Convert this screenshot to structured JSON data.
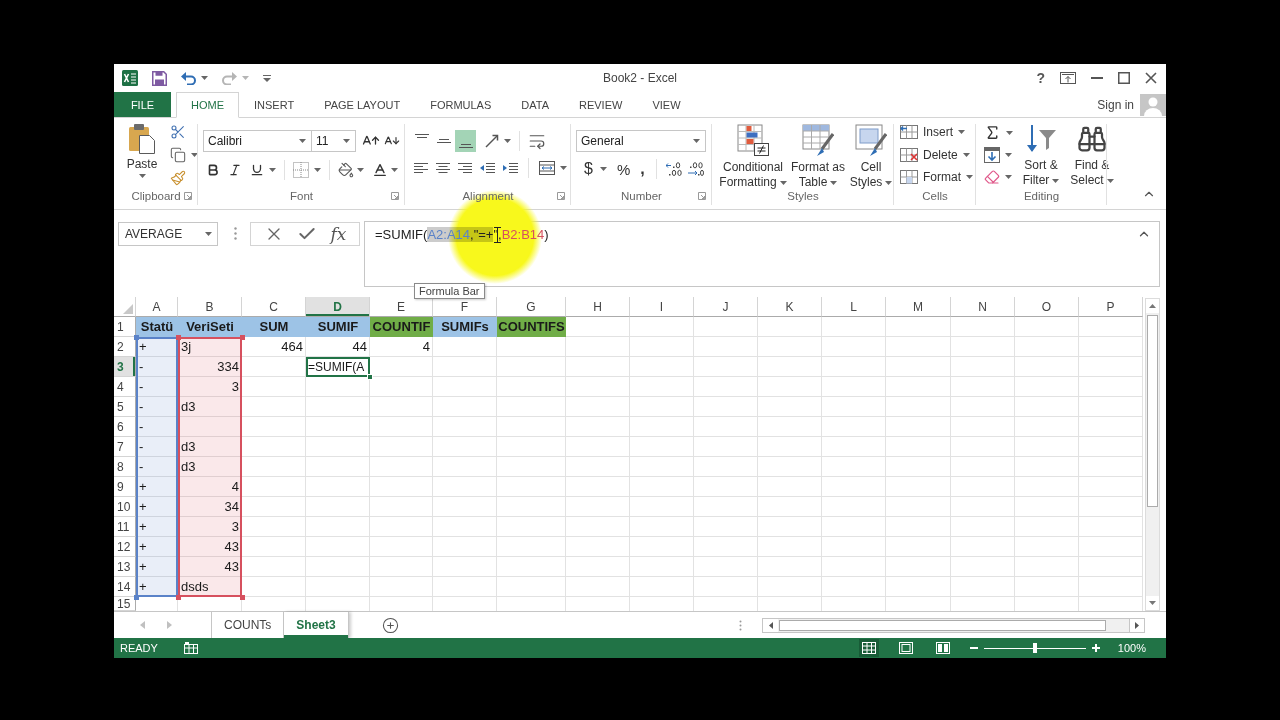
{
  "window": {
    "title": "Book2 - Excel",
    "help": "?"
  },
  "tabs": [
    {
      "label": "FILE",
      "kind": "file",
      "selected": false
    },
    {
      "label": "HOME",
      "kind": "tab",
      "selected": true
    },
    {
      "label": "INSERT",
      "kind": "tab",
      "selected": false
    },
    {
      "label": "PAGE LAYOUT",
      "kind": "tab",
      "selected": false
    },
    {
      "label": "FORMULAS",
      "kind": "tab",
      "selected": false
    },
    {
      "label": "DATA",
      "kind": "tab",
      "selected": false
    },
    {
      "label": "REVIEW",
      "kind": "tab",
      "selected": false
    },
    {
      "label": "VIEW",
      "kind": "tab",
      "selected": false
    }
  ],
  "account": {
    "label": "Sign in"
  },
  "ribbon": {
    "clipboard": {
      "label": "Clipboard",
      "paste": "Paste"
    },
    "font": {
      "label": "Font",
      "font_name": "Calibri",
      "font_size": "11"
    },
    "alignment": {
      "label": "Alignment",
      "vertical": [
        {
          "kind": "top",
          "selected": false
        },
        {
          "kind": "middle",
          "selected": false
        },
        {
          "kind": "bottom",
          "selected": true
        }
      ]
    },
    "number": {
      "label": "Number",
      "format": "General",
      "currency": "$",
      "percent": "%",
      "comma": ","
    },
    "styles": {
      "label": "Styles",
      "buttons": [
        {
          "label": "Conditional Formatting",
          "kind": "conditional"
        },
        {
          "label": "Format as Table",
          "kind": "table"
        },
        {
          "label": "Cell Styles",
          "kind": "cell-styles"
        }
      ]
    },
    "cells": {
      "label": "Cells",
      "buttons": [
        {
          "label": "Insert",
          "kind": "insert"
        },
        {
          "label": "Delete",
          "kind": "delete"
        },
        {
          "label": "Format",
          "kind": "format"
        }
      ]
    },
    "editing": {
      "label": "Editing",
      "buttons": [
        {
          "label": "Sort & Filter",
          "kind": "sort"
        },
        {
          "label": "Find & Select",
          "kind": "find"
        }
      ]
    }
  },
  "formula_bar": {
    "name_box": "AVERAGE",
    "insert_function": "fx",
    "formula": [
      {
        "text": "=SUMIF(",
        "selected": false
      },
      {
        "text": "A2:A14",
        "color": "#5a82c8",
        "selected": true
      },
      {
        "text": ",\"=+",
        "selected": true
      },
      {
        "text": "\",",
        "selected": false
      },
      {
        "text": "B2:B14",
        "color": "#d6505e",
        "selected": false
      },
      {
        "text": ")",
        "selected": false
      }
    ],
    "tooltip": "Formula Bar"
  },
  "grid": {
    "columns": [
      {
        "label": "A",
        "selected": false
      },
      {
        "label": "B",
        "selected": false
      },
      {
        "label": "C",
        "selected": false
      },
      {
        "label": "D",
        "selected": true
      },
      {
        "label": "E",
        "selected": false
      },
      {
        "label": "F",
        "selected": false
      },
      {
        "label": "G",
        "selected": false
      },
      {
        "label": "H",
        "selected": false
      },
      {
        "label": "I",
        "selected": false
      },
      {
        "label": "J",
        "selected": false
      },
      {
        "label": "K",
        "selected": false
      },
      {
        "label": "L",
        "selected": false
      },
      {
        "label": "M",
        "selected": false
      },
      {
        "label": "N",
        "selected": false
      },
      {
        "label": "O",
        "selected": false
      },
      {
        "label": "P",
        "selected": false
      }
    ],
    "rows": [
      {
        "number": "1",
        "selected": false,
        "cells": [
          {
            "text": "Statü",
            "kind": "header",
            "color": "#9dc3e6",
            "active": false
          },
          {
            "text": "VeriSeti",
            "kind": "header",
            "color": "#9dc3e6",
            "active": false
          },
          {
            "text": "SUM",
            "kind": "header",
            "color": "#9dc3e6",
            "active": false
          },
          {
            "text": "SUMIF",
            "kind": "header",
            "color": "#9dc3e6",
            "active": false
          },
          {
            "text": "COUNTIF",
            "kind": "header",
            "color": "#70ad47",
            "active": false
          },
          {
            "text": "SUMIFs",
            "kind": "header",
            "color": "#9dc3e6",
            "active": false
          },
          {
            "text": "COUNTIFS",
            "kind": "header",
            "color": "#70ad47",
            "active": false
          }
        ]
      },
      {
        "number": "2",
        "selected": false,
        "cells": [
          {
            "text": "+",
            "kind": "text",
            "color": "#5a82c8",
            "active": false
          },
          {
            "text": "3j",
            "kind": "text",
            "color": "#d6505e",
            "active": false
          },
          {
            "text": "464",
            "kind": "number",
            "active": false
          },
          {
            "text": "44",
            "kind": "number",
            "active": false
          },
          {
            "text": "4",
            "kind": "number",
            "active": false
          }
        ]
      },
      {
        "number": "3",
        "selected": true,
        "cells": [
          {
            "text": "-",
            "kind": "text",
            "color": "#5a82c8",
            "active": false
          },
          {
            "text": "334",
            "kind": "number",
            "color": "#d6505e",
            "active": false
          },
          null,
          {
            "text": "=SUMIF(A",
            "kind": "text",
            "active": true
          }
        ]
      },
      {
        "number": "4",
        "selected": false,
        "cells": [
          {
            "text": "-",
            "kind": "text",
            "color": "#5a82c8",
            "active": false
          },
          {
            "text": "3",
            "kind": "number",
            "color": "#d6505e",
            "active": false
          }
        ]
      },
      {
        "number": "5",
        "selected": false,
        "cells": [
          {
            "text": "-",
            "kind": "text",
            "color": "#5a82c8",
            "active": false
          },
          {
            "text": "d3",
            "kind": "text",
            "color": "#d6505e",
            "active": false
          }
        ]
      },
      {
        "number": "6",
        "selected": false,
        "cells": [
          {
            "text": "-",
            "kind": "text",
            "color": "#5a82c8",
            "active": false
          },
          {
            "color": "#d6505e",
            "active": false
          }
        ]
      },
      {
        "number": "7",
        "selected": false,
        "cells": [
          {
            "text": "-",
            "kind": "text",
            "color": "#5a82c8",
            "active": false
          },
          {
            "text": "d3",
            "kind": "text",
            "color": "#d6505e",
            "active": false
          }
        ]
      },
      {
        "number": "8",
        "selected": false,
        "cells": [
          {
            "text": "-",
            "kind": "text",
            "color": "#5a82c8",
            "active": false
          },
          {
            "text": "d3",
            "kind": "text",
            "color": "#d6505e",
            "active": false
          }
        ]
      },
      {
        "number": "9",
        "selected": false,
        "cells": [
          {
            "text": "+",
            "kind": "text",
            "color": "#5a82c8",
            "active": false
          },
          {
            "text": "4",
            "kind": "number",
            "color": "#d6505e",
            "active": false
          }
        ]
      },
      {
        "number": "10",
        "selected": false,
        "cells": [
          {
            "text": "+",
            "kind": "text",
            "color": "#5a82c8",
            "active": false
          },
          {
            "text": "34",
            "kind": "number",
            "color": "#d6505e",
            "active": false
          }
        ]
      },
      {
        "number": "11",
        "selected": false,
        "cells": [
          {
            "text": "+",
            "kind": "text",
            "color": "#5a82c8",
            "active": false
          },
          {
            "text": "3",
            "kind": "number",
            "color": "#d6505e",
            "active": false
          }
        ]
      },
      {
        "number": "12",
        "selected": false,
        "cells": [
          {
            "text": "+",
            "kind": "text",
            "color": "#5a82c8",
            "active": false
          },
          {
            "text": "43",
            "kind": "number",
            "color": "#d6505e",
            "active": false
          }
        ]
      },
      {
        "number": "13",
        "selected": false,
        "cells": [
          {
            "text": "+",
            "kind": "text",
            "color": "#5a82c8",
            "active": false
          },
          {
            "text": "43",
            "kind": "number",
            "color": "#d6505e",
            "active": false
          }
        ]
      },
      {
        "number": "14",
        "selected": false,
        "cells": [
          {
            "text": "+",
            "kind": "text",
            "color": "#5a82c8",
            "active": false
          },
          {
            "text": "dsds",
            "kind": "text",
            "color": "#d6505e",
            "active": false
          }
        ]
      },
      {
        "number": "15",
        "selected": false
      }
    ]
  },
  "sheets": [
    {
      "label": "COUNTs",
      "selected": false
    },
    {
      "label": "Sheet3",
      "selected": true
    }
  ],
  "status_bar": {
    "mode": "READY",
    "views": [
      {
        "kind": "normal",
        "selected": true
      },
      {
        "kind": "page-layout",
        "selected": false
      },
      {
        "kind": "page-break",
        "selected": false
      }
    ],
    "zoom_slider": {
      "level": 0.5
    },
    "zoom": "100%"
  }
}
